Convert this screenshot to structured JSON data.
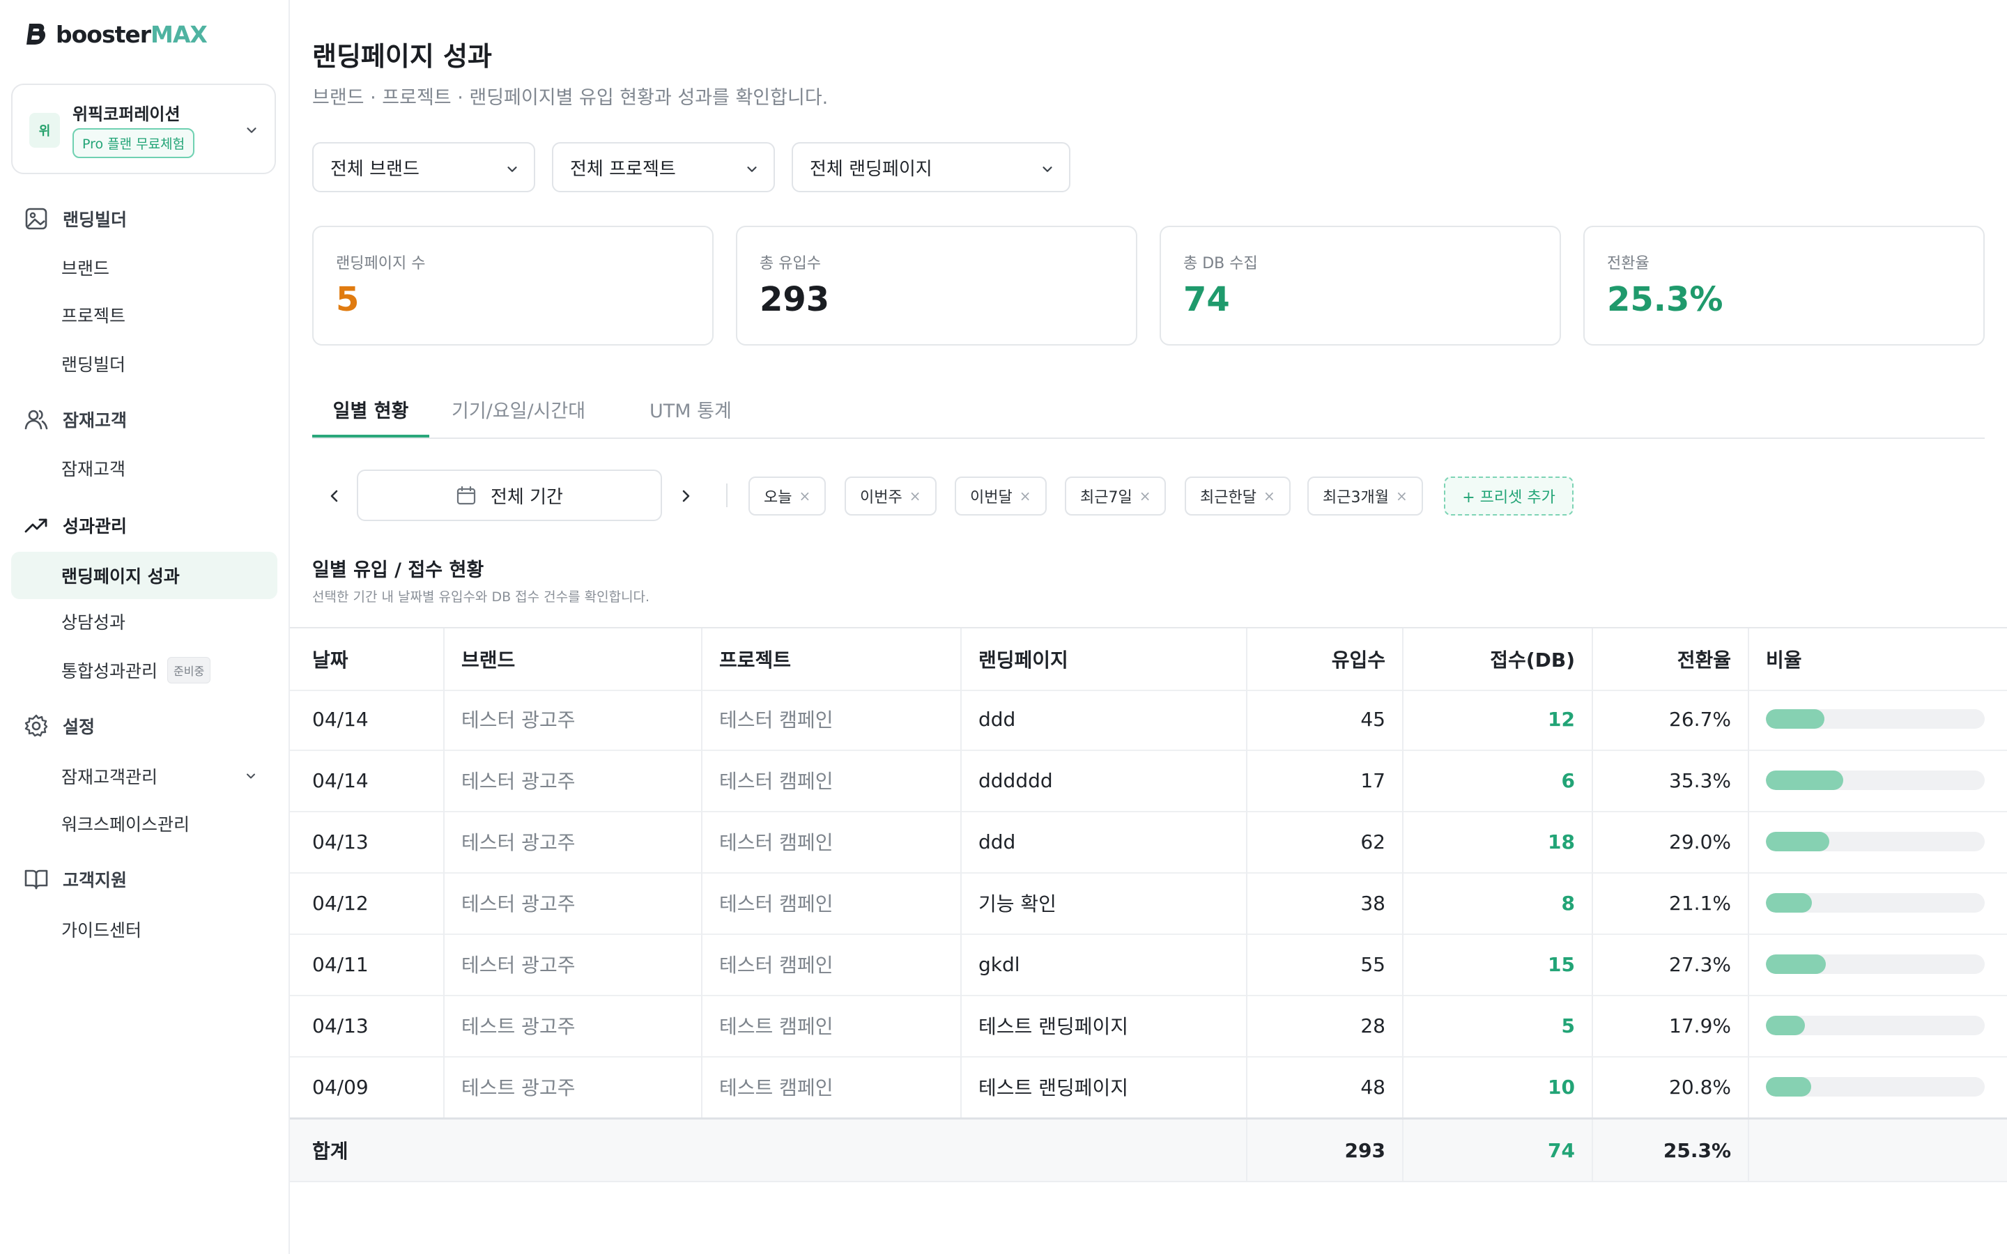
{
  "app": {
    "logo_text": "booster",
    "logo_accent": "MAX"
  },
  "workspace": {
    "avatar": "위",
    "name": "위픽코퍼레이션",
    "plan": "Pro 플랜 무료체험"
  },
  "sidebar": {
    "sections": [
      {
        "label": "랜딩빌더",
        "icon": "image-icon",
        "items": [
          {
            "label": "브랜드"
          },
          {
            "label": "프로젝트"
          },
          {
            "label": "랜딩빌더"
          }
        ]
      },
      {
        "label": "잠재고객",
        "icon": "users-icon",
        "items": [
          {
            "label": "잠재고객"
          }
        ]
      },
      {
        "label": "성과관리",
        "icon": "trending-up-icon",
        "items": [
          {
            "label": "랜딩페이지 성과"
          },
          {
            "label": "상담성과"
          },
          {
            "label": "통합성과관리",
            "badge": "준비중"
          }
        ]
      },
      {
        "label": "설정",
        "icon": "gear-icon",
        "items": [
          {
            "label": "잠재고객관리"
          },
          {
            "label": "워크스페이스관리"
          }
        ]
      },
      {
        "label": "고객지원",
        "icon": "book-icon",
        "items": [
          {
            "label": "가이드센터"
          }
        ]
      }
    ]
  },
  "page": {
    "title": "랜딩페이지 성과",
    "subtitle": "브랜드 · 프로젝트 · 랜딩페이지별 유입 현황과 성과를 확인합니다."
  },
  "filters": {
    "brand": "전체 브랜드",
    "project": "전체 프로젝트",
    "landing": "전체 랜딩페이지"
  },
  "stats": [
    {
      "label": "랜딩페이지 수",
      "value": "5",
      "color": "#e07b10"
    },
    {
      "label": "총 유입수",
      "value": "293",
      "color": "#1a1d22"
    },
    {
      "label": "총 DB 수집",
      "value": "74",
      "color": "#1f9a6c"
    },
    {
      "label": "전환율",
      "value": "25.3%",
      "color": "#1f9a6c"
    }
  ],
  "tabs": [
    {
      "label": "일별 현황"
    },
    {
      "label": "기기/요일/시간대"
    },
    {
      "label": "UTM 통계"
    }
  ],
  "date_range": {
    "label": "전체 기간"
  },
  "presets": [
    {
      "label": "오늘"
    },
    {
      "label": "이번주"
    },
    {
      "label": "이번달"
    },
    {
      "label": "최근7일"
    },
    {
      "label": "최근한달"
    },
    {
      "label": "최근3개월"
    }
  ],
  "preset_add": "+ 프리셋 추가",
  "section": {
    "title": "일별 유입 / 접수 현황",
    "subtitle": "선택한 기간 내 날짜별 유입수와 DB 접수 건수를 확인합니다."
  },
  "table": {
    "headers": {
      "date": "날짜",
      "brand": "브랜드",
      "project": "프로젝트",
      "landing": "랜딩페이지",
      "visits": "유입수",
      "db": "접수(DB)",
      "rate": "전환율",
      "ratio": "비율"
    },
    "rows": [
      {
        "date": "04/14",
        "brand": "테스터 광고주",
        "project": "테스터 캠페인",
        "landing": "ddd",
        "visits": "45",
        "db": "12",
        "rate": "26.7%",
        "ratio": 0.267
      },
      {
        "date": "04/14",
        "brand": "테스터 광고주",
        "project": "테스터 캠페인",
        "landing": "dddddd",
        "visits": "17",
        "db": "6",
        "rate": "35.3%",
        "ratio": 0.353
      },
      {
        "date": "04/13",
        "brand": "테스터 광고주",
        "project": "테스터 캠페인",
        "landing": "ddd",
        "visits": "62",
        "db": "18",
        "rate": "29.0%",
        "ratio": 0.29
      },
      {
        "date": "04/12",
        "brand": "테스터 광고주",
        "project": "테스터 캠페인",
        "landing": "기능 확인",
        "visits": "38",
        "db": "8",
        "rate": "21.1%",
        "ratio": 0.211
      },
      {
        "date": "04/11",
        "brand": "테스터 광고주",
        "project": "테스터 캠페인",
        "landing": "gkdl",
        "visits": "55",
        "db": "15",
        "rate": "27.3%",
        "ratio": 0.273
      },
      {
        "date": "04/13",
        "brand": "테스트 광고주",
        "project": "테스트 캠페인",
        "landing": "테스트 랜딩페이지",
        "visits": "28",
        "db": "5",
        "rate": "17.9%",
        "ratio": 0.179
      },
      {
        "date": "04/09",
        "brand": "테스트 광고주",
        "project": "테스트 캠페인",
        "landing": "테스트 랜딩페이지",
        "visits": "48",
        "db": "10",
        "rate": "20.8%",
        "ratio": 0.208
      }
    ],
    "total": {
      "label": "합계",
      "visits": "293",
      "db": "74",
      "rate": "25.3%"
    }
  }
}
